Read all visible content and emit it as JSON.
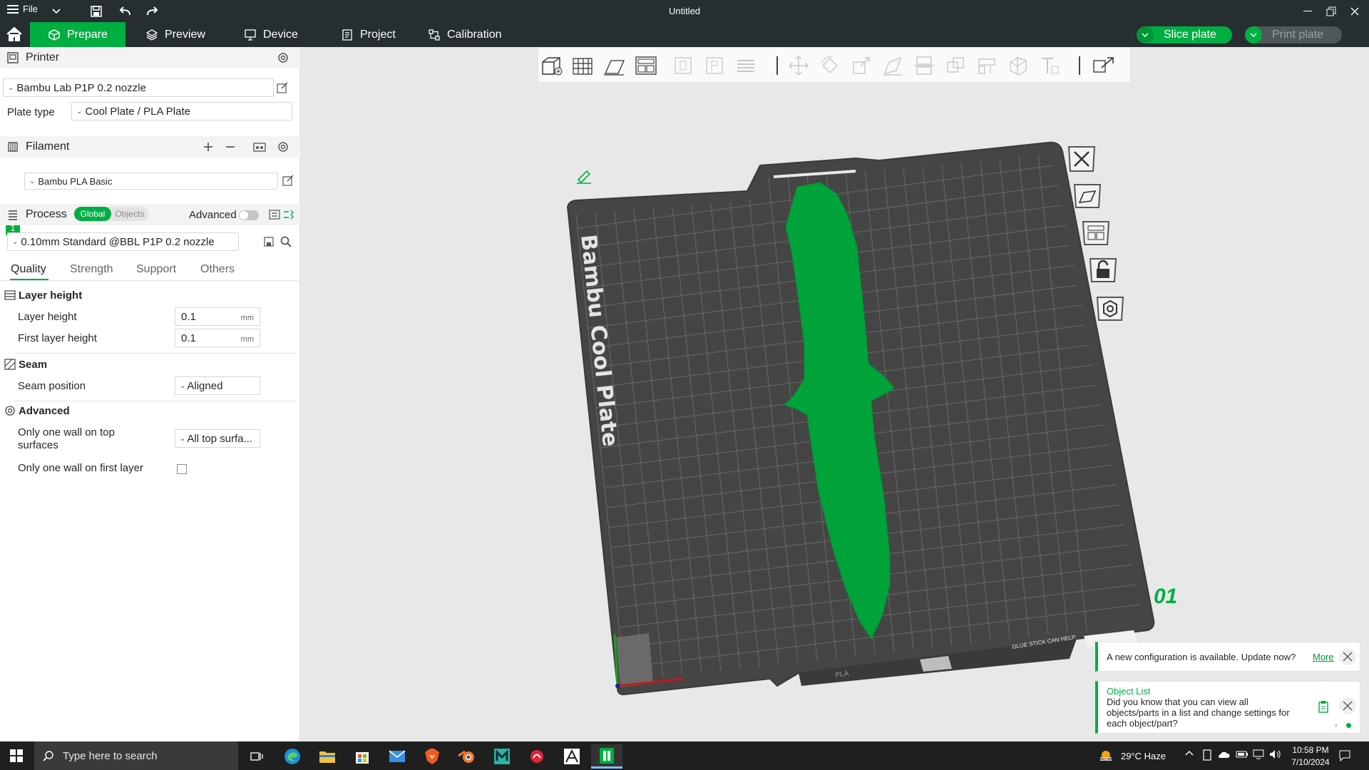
{
  "titlebar": {
    "file_label": "File",
    "title": "Untitled"
  },
  "nav": {
    "tabs": [
      {
        "label": "Prepare",
        "active": true
      },
      {
        "label": "Preview"
      },
      {
        "label": "Device"
      },
      {
        "label": "Project"
      },
      {
        "label": "Calibration"
      }
    ],
    "slice_label": "Slice plate",
    "print_label": "Print plate"
  },
  "printer": {
    "section_label": "Printer",
    "name": "Bambu Lab P1P 0.2 nozzle",
    "plate_type_label": "Plate type",
    "plate_type_value": "Cool Plate / PLA Plate"
  },
  "filament": {
    "section_label": "Filament",
    "slot_number": "1",
    "name": "Bambu PLA Basic",
    "slot_color": "#00ae42"
  },
  "process": {
    "section_label": "Process",
    "toggle_on": "Global",
    "toggle_off": "Objects",
    "advanced_label": "Advanced",
    "preset": "0.10mm Standard @BBL P1P 0.2 nozzle",
    "tabs": [
      "Quality",
      "Strength",
      "Support",
      "Others"
    ]
  },
  "quality": {
    "layer_group": "Layer height",
    "layer_height_label": "Layer height",
    "layer_height_value": "0.1",
    "first_layer_label": "First layer height",
    "first_layer_value": "0.1",
    "unit": "mm",
    "seam_group": "Seam",
    "seam_position_label": "Seam position",
    "seam_position_value": "Aligned",
    "advanced_group": "Advanced",
    "one_wall_top_label_1": "Only one wall on top",
    "one_wall_top_label_2": "surfaces",
    "one_wall_top_value": "All top surfa...",
    "one_wall_first_label": "Only one wall on first layer",
    "one_wall_first_checked": false
  },
  "plate": {
    "plate_text": "Bambu Cool Plate",
    "plate_number": "01",
    "glue_text": "GLUE STICK CAN HELP.",
    "pla_text": "PLA",
    "model_color": "#00a33a",
    "bed_color": "#454545"
  },
  "notifications": {
    "update_text": "A new configuration is available. Update now?",
    "update_link": "More",
    "tip_title": "Object List",
    "tip_line1": "Did you know that you can view all",
    "tip_line2": "objects/parts in a list and change settings for",
    "tip_line3": "each object/part?"
  },
  "taskbar": {
    "search_placeholder": "Type here to search",
    "weather": "29°C  Haze",
    "time": "10:58 PM",
    "date": "7/10/2024"
  },
  "colors": {
    "accent": "#00ae42",
    "header": "#262e30"
  }
}
